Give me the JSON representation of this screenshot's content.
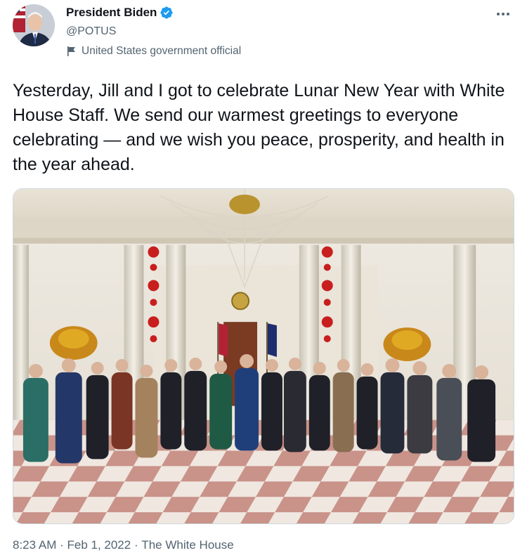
{
  "user": {
    "display_name": "President Biden",
    "handle": "@POTUS",
    "label": "United States government official",
    "verified": true
  },
  "tweet": {
    "text": "Yesterday, Jill and I got to celebrate Lunar New Year with White House Staff. We send our warmest greetings to everyone celebrating — and we wish you peace, prosperity, and health in the year ahead.",
    "time": "8:23 AM",
    "date": "Feb 1, 2022",
    "source": "The White House",
    "separator": " · "
  },
  "icons": {
    "verified": "verified-badge-icon",
    "label": "flag-icon",
    "more": "more-options-icon"
  },
  "colors": {
    "verified_blue": "#1d9bf0",
    "secondary_text": "#536471",
    "primary_text": "#0f1419"
  }
}
